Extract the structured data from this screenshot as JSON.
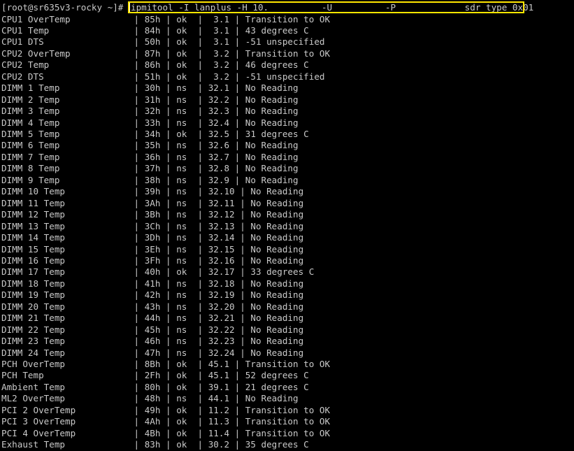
{
  "terminal": {
    "prompt": "[root@sr635v3-rocky ~]#",
    "command": "ipmitool -I lanplus -H 10.          -U          -P             sdr type 0x01",
    "highlight_color": "#ffe600",
    "text_color": "#c9c9c9",
    "background": "#000000"
  },
  "rows": [
    {
      "text": "CPU1 OverTemp            | 85h | ok  |  3.1 | Transition to OK"
    },
    {
      "text": "CPU1 Temp                | 84h | ok  |  3.1 | 43 degrees C"
    },
    {
      "text": "CPU1 DTS                 | 50h | ok  |  3.1 | -51 unspecified"
    },
    {
      "text": "CPU2 OverTemp            | 87h | ok  |  3.2 | Transition to OK"
    },
    {
      "text": "CPU2 Temp                | 86h | ok  |  3.2 | 46 degrees C"
    },
    {
      "text": "CPU2 DTS                 | 51h | ok  |  3.2 | -51 unspecified"
    },
    {
      "text": "DIMM 1 Temp              | 30h | ns  | 32.1 | No Reading"
    },
    {
      "text": "DIMM 2 Temp              | 31h | ns  | 32.2 | No Reading"
    },
    {
      "text": "DIMM 3 Temp              | 32h | ns  | 32.3 | No Reading"
    },
    {
      "text": "DIMM 4 Temp              | 33h | ns  | 32.4 | No Reading"
    },
    {
      "text": "DIMM 5 Temp              | 34h | ok  | 32.5 | 31 degrees C"
    },
    {
      "text": "DIMM 6 Temp              | 35h | ns  | 32.6 | No Reading"
    },
    {
      "text": "DIMM 7 Temp              | 36h | ns  | 32.7 | No Reading"
    },
    {
      "text": "DIMM 8 Temp              | 37h | ns  | 32.8 | No Reading"
    },
    {
      "text": "DIMM 9 Temp              | 38h | ns  | 32.9 | No Reading"
    },
    {
      "text": "DIMM 10 Temp             | 39h | ns  | 32.10 | No Reading"
    },
    {
      "text": "DIMM 11 Temp             | 3Ah | ns  | 32.11 | No Reading"
    },
    {
      "text": "DIMM 12 Temp             | 3Bh | ns  | 32.12 | No Reading"
    },
    {
      "text": "DIMM 13 Temp             | 3Ch | ns  | 32.13 | No Reading"
    },
    {
      "text": "DIMM 14 Temp             | 3Dh | ns  | 32.14 | No Reading"
    },
    {
      "text": "DIMM 15 Temp             | 3Eh | ns  | 32.15 | No Reading"
    },
    {
      "text": "DIMM 16 Temp             | 3Fh | ns  | 32.16 | No Reading"
    },
    {
      "text": "DIMM 17 Temp             | 40h | ok  | 32.17 | 33 degrees C"
    },
    {
      "text": "DIMM 18 Temp             | 41h | ns  | 32.18 | No Reading"
    },
    {
      "text": "DIMM 19 Temp             | 42h | ns  | 32.19 | No Reading"
    },
    {
      "text": "DIMM 20 Temp             | 43h | ns  | 32.20 | No Reading"
    },
    {
      "text": "DIMM 21 Temp             | 44h | ns  | 32.21 | No Reading"
    },
    {
      "text": "DIMM 22 Temp             | 45h | ns  | 32.22 | No Reading"
    },
    {
      "text": "DIMM 23 Temp             | 46h | ns  | 32.23 | No Reading"
    },
    {
      "text": "DIMM 24 Temp             | 47h | ns  | 32.24 | No Reading"
    },
    {
      "text": "PCH OverTemp             | 8Bh | ok  | 45.1 | Transition to OK"
    },
    {
      "text": "PCH Temp                 | 2Fh | ok  | 45.1 | 52 degrees C"
    },
    {
      "text": "Ambient Temp             | 80h | ok  | 39.1 | 21 degrees C"
    },
    {
      "text": "ML2 OverTemp             | 48h | ns  | 44.1 | No Reading"
    },
    {
      "text": "PCI 2 OverTemp           | 49h | ok  | 11.2 | Transition to OK"
    },
    {
      "text": "PCI 3 OverTemp           | 4Ah | ok  | 11.3 | Transition to OK"
    },
    {
      "text": "PCI 4 OverTemp           | 4Bh | ok  | 11.4 | Transition to OK"
    },
    {
      "text": "Exhaust Temp             | 83h | ok  | 30.2 | 35 degrees C"
    }
  ]
}
